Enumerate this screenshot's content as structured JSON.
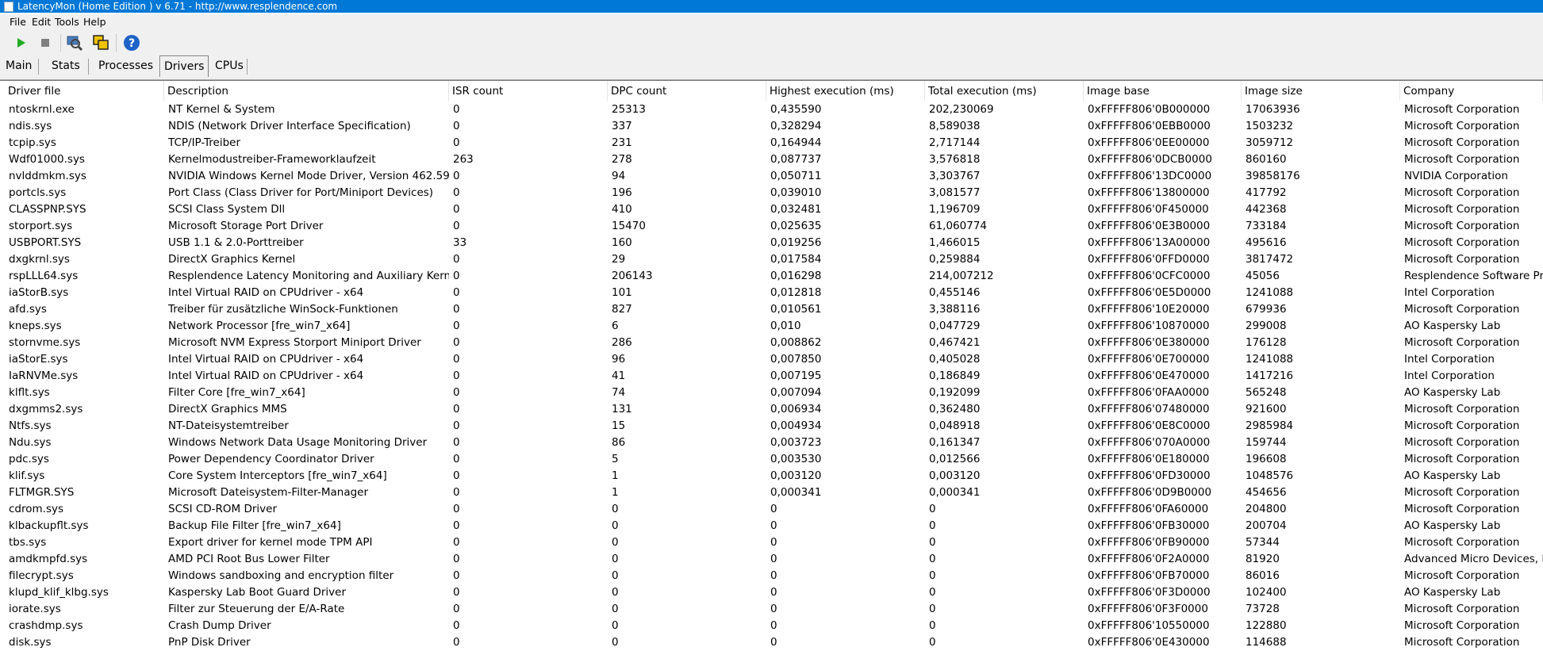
{
  "window": {
    "title": "LatencyMon  (Home Edition )  v 6.71 - http://www.resplendence.com"
  },
  "menu": [
    "File",
    "Edit",
    "Tools",
    "Help"
  ],
  "toolbar": {
    "buttons": [
      "play-icon",
      "stop-icon",
      "search-icon",
      "windows-icon",
      "help-icon"
    ],
    "colors": {
      "play": "#22aa22",
      "stop": "#808080",
      "help": "#1e63c8"
    }
  },
  "tabs": [
    "Main",
    "Stats",
    "Processes",
    "Drivers",
    "CPUs"
  ],
  "active_tab": "Drivers",
  "table": {
    "columns": [
      "Driver file",
      "Description",
      "ISR count",
      "DPC count",
      "Highest execution (ms)",
      "Total execution (ms)",
      "Image base",
      "Image size",
      "Company"
    ],
    "rows": [
      [
        "ntoskrnl.exe",
        "NT Kernel & System",
        "0",
        "25313",
        "0,435590",
        "202,230069",
        "0xFFFFF806'0B000000",
        "17063936",
        "Microsoft Corporation"
      ],
      [
        "ndis.sys",
        "NDIS (Network Driver Interface Specification)",
        "0",
        "337",
        "0,328294",
        "8,589038",
        "0xFFFFF806'0EBB0000",
        "1503232",
        "Microsoft Corporation"
      ],
      [
        "tcpip.sys",
        "TCP/IP-Treiber",
        "0",
        "231",
        "0,164944",
        "2,717144",
        "0xFFFFF806'0EE00000",
        "3059712",
        "Microsoft Corporation"
      ],
      [
        "Wdf01000.sys",
        "Kernelmodustreiber-Frameworklaufzeit",
        "263",
        "278",
        "0,087737",
        "3,576818",
        "0xFFFFF806'0DCB0000",
        "860160",
        "Microsoft Corporation"
      ],
      [
        "nvlddmkm.sys",
        "NVIDIA Windows Kernel Mode Driver, Version 462.59",
        "0",
        "94",
        "0,050711",
        "3,303767",
        "0xFFFFF806'13DC0000",
        "39858176",
        "NVIDIA Corporation"
      ],
      [
        "portcls.sys",
        "Port Class (Class Driver for Port/Miniport Devices)",
        "0",
        "196",
        "0,039010",
        "3,081577",
        "0xFFFFF806'13800000",
        "417792",
        "Microsoft Corporation"
      ],
      [
        "CLASSPNP.SYS",
        "SCSI Class System Dll",
        "0",
        "410",
        "0,032481",
        "1,196709",
        "0xFFFFF806'0F450000",
        "442368",
        "Microsoft Corporation"
      ],
      [
        "storport.sys",
        "Microsoft Storage Port Driver",
        "0",
        "15470",
        "0,025635",
        "61,060774",
        "0xFFFFF806'0E3B0000",
        "733184",
        "Microsoft Corporation"
      ],
      [
        "USBPORT.SYS",
        "USB 1.1 & 2.0-Porttreiber",
        "33",
        "160",
        "0,019256",
        "1,466015",
        "0xFFFFF806'13A00000",
        "495616",
        "Microsoft Corporation"
      ],
      [
        "dxgkrnl.sys",
        "DirectX Graphics Kernel",
        "0",
        "29",
        "0,017584",
        "0,259884",
        "0xFFFFF806'0FFD0000",
        "3817472",
        "Microsoft Corporation"
      ],
      [
        "rspLLL64.sys",
        "Resplendence Latency Monitoring and Auxiliary Kernel ...",
        "0",
        "206143",
        "0,016298",
        "214,007212",
        "0xFFFFF806'0CFC0000",
        "45056",
        "Resplendence Software Proj..."
      ],
      [
        "iaStorB.sys",
        "Intel Virtual RAID on CPUdriver - x64",
        "0",
        "101",
        "0,012818",
        "0,455146",
        "0xFFFFF806'0E5D0000",
        "1241088",
        "Intel Corporation"
      ],
      [
        "afd.sys",
        "Treiber für zusätzliche WinSock-Funktionen",
        "0",
        "827",
        "0,010561",
        "3,388116",
        "0xFFFFF806'10E20000",
        "679936",
        "Microsoft Corporation"
      ],
      [
        "kneps.sys",
        "Network Processor [fre_win7_x64]",
        "0",
        "6",
        "0,010",
        "0,047729",
        "0xFFFFF806'10870000",
        "299008",
        "AO Kaspersky Lab"
      ],
      [
        "stornvme.sys",
        "Microsoft NVM Express Storport Miniport Driver",
        "0",
        "286",
        "0,008862",
        "0,467421",
        "0xFFFFF806'0E380000",
        "176128",
        "Microsoft Corporation"
      ],
      [
        "iaStorE.sys",
        "Intel Virtual RAID on CPUdriver - x64",
        "0",
        "96",
        "0,007850",
        "0,405028",
        "0xFFFFF806'0E700000",
        "1241088",
        "Intel Corporation"
      ],
      [
        "IaRNVMe.sys",
        "Intel Virtual RAID on CPUdriver - x64",
        "0",
        "41",
        "0,007195",
        "0,186849",
        "0xFFFFF806'0E470000",
        "1417216",
        "Intel Corporation"
      ],
      [
        "klflt.sys",
        "Filter Core [fre_win7_x64]",
        "0",
        "74",
        "0,007094",
        "0,192099",
        "0xFFFFF806'0FAA0000",
        "565248",
        "AO Kaspersky Lab"
      ],
      [
        "dxgmms2.sys",
        "DirectX Graphics MMS",
        "0",
        "131",
        "0,006934",
        "0,362480",
        "0xFFFFF806'07480000",
        "921600",
        "Microsoft Corporation"
      ],
      [
        "Ntfs.sys",
        "NT-Dateisystemtreiber",
        "0",
        "15",
        "0,004934",
        "0,048918",
        "0xFFFFF806'0E8C0000",
        "2985984",
        "Microsoft Corporation"
      ],
      [
        "Ndu.sys",
        "Windows Network Data Usage Monitoring Driver",
        "0",
        "86",
        "0,003723",
        "0,161347",
        "0xFFFFF806'070A0000",
        "159744",
        "Microsoft Corporation"
      ],
      [
        "pdc.sys",
        "Power Dependency Coordinator Driver",
        "0",
        "5",
        "0,003530",
        "0,012566",
        "0xFFFFF806'0E180000",
        "196608",
        "Microsoft Corporation"
      ],
      [
        "klif.sys",
        "Core System Interceptors [fre_win7_x64]",
        "0",
        "1",
        "0,003120",
        "0,003120",
        "0xFFFFF806'0FD30000",
        "1048576",
        "AO Kaspersky Lab"
      ],
      [
        "FLTMGR.SYS",
        "Microsoft Dateisystem-Filter-Manager",
        "0",
        "1",
        "0,000341",
        "0,000341",
        "0xFFFFF806'0D9B0000",
        "454656",
        "Microsoft Corporation"
      ],
      [
        "cdrom.sys",
        "SCSI CD-ROM Driver",
        "0",
        "0",
        "0",
        "0",
        "0xFFFFF806'0FA60000",
        "204800",
        "Microsoft Corporation"
      ],
      [
        "klbackupflt.sys",
        "Backup File Filter [fre_win7_x64]",
        "0",
        "0",
        "0",
        "0",
        "0xFFFFF806'0FB30000",
        "200704",
        "AO Kaspersky Lab"
      ],
      [
        "tbs.sys",
        "Export driver for kernel mode TPM API",
        "0",
        "0",
        "0",
        "0",
        "0xFFFFF806'0FB90000",
        "57344",
        "Microsoft Corporation"
      ],
      [
        "amdkmpfd.sys",
        "AMD PCI Root Bus Lower Filter",
        "0",
        "0",
        "0",
        "0",
        "0xFFFFF806'0F2A0000",
        "81920",
        "Advanced Micro Devices, Inc"
      ],
      [
        "filecrypt.sys",
        "Windows sandboxing and encryption filter",
        "0",
        "0",
        "0",
        "0",
        "0xFFFFF806'0FB70000",
        "86016",
        "Microsoft Corporation"
      ],
      [
        "klupd_klif_klbg.sys",
        "Kaspersky Lab Boot Guard Driver",
        "0",
        "0",
        "0",
        "0",
        "0xFFFFF806'0F3D0000",
        "102400",
        "AO Kaspersky Lab"
      ],
      [
        "iorate.sys",
        "Filter zur Steuerung der E/A-Rate",
        "0",
        "0",
        "0",
        "0",
        "0xFFFFF806'0F3F0000",
        "73728",
        "Microsoft Corporation"
      ],
      [
        "crashdmp.sys",
        "Crash Dump Driver",
        "0",
        "0",
        "0",
        "0",
        "0xFFFFF806'10550000",
        "122880",
        "Microsoft Corporation"
      ],
      [
        "disk.sys",
        "PnP Disk Driver",
        "0",
        "0",
        "0",
        "0",
        "0xFFFFF806'0E430000",
        "114688",
        "Microsoft Corporation"
      ]
    ]
  }
}
